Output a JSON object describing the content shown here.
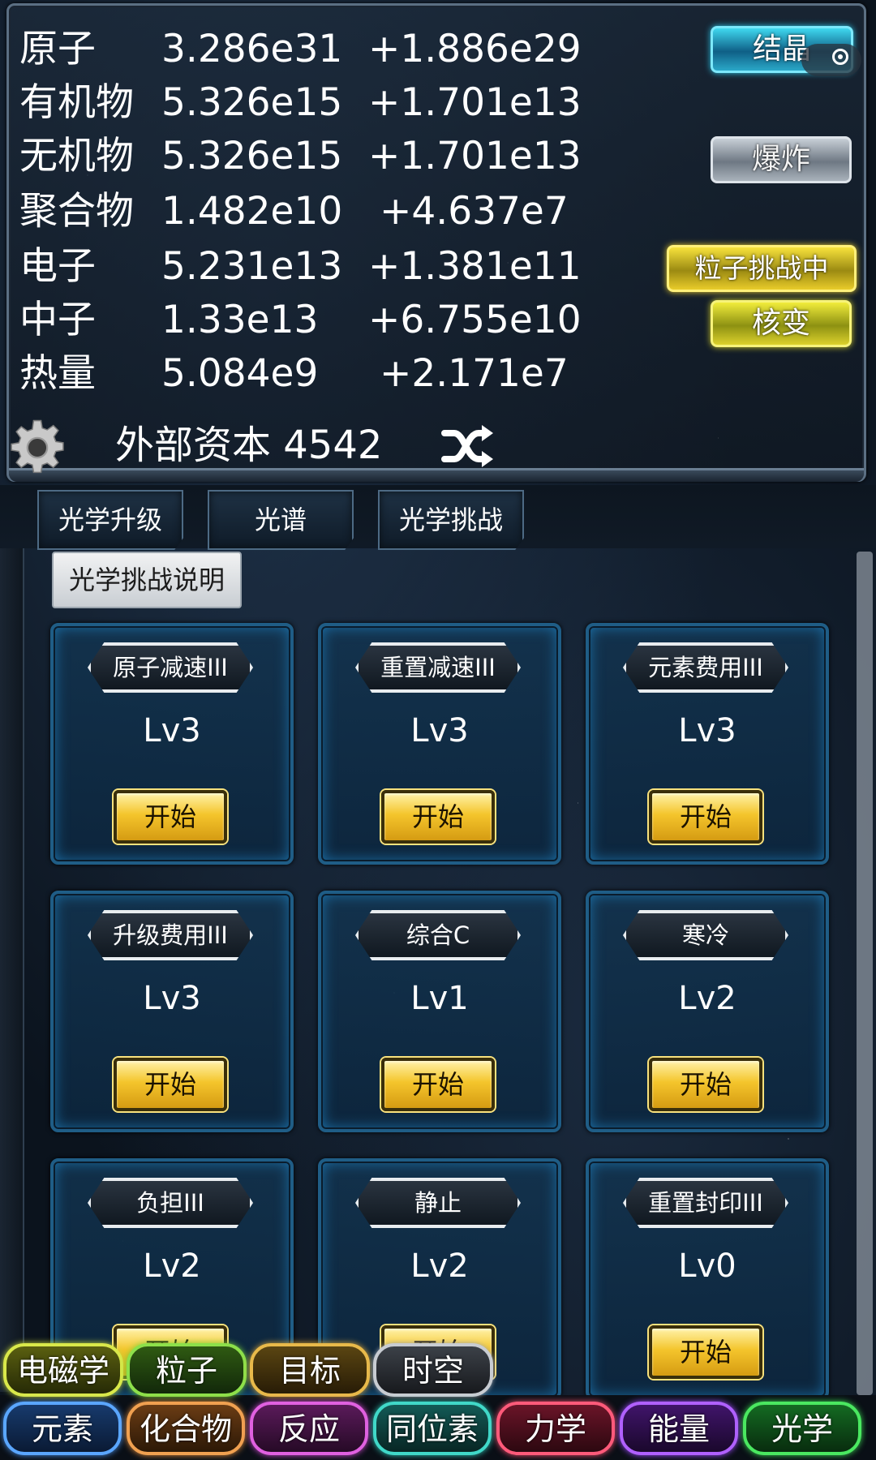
{
  "resources": [
    {
      "name": "原子",
      "value": "3.286e31",
      "rate": "+1.886e29"
    },
    {
      "name": "有机物",
      "value": "5.326e15",
      "rate": "+1.701e13"
    },
    {
      "name": "无机物",
      "value": "5.326e15",
      "rate": "+1.701e13"
    },
    {
      "name": "聚合物",
      "value": "1.482e10",
      "rate": "+4.637e7"
    },
    {
      "name": "电子",
      "value": "5.231e13",
      "rate": "+1.381e11"
    },
    {
      "name": "中子",
      "value": "1.33e13",
      "rate": "+6.755e10"
    },
    {
      "name": "热量",
      "value": "5.084e9",
      "rate": "+2.171e7"
    }
  ],
  "side_buttons": {
    "crystal": "结晶",
    "explode": "爆炸",
    "particle_challenge": "粒子挑战中",
    "nuclear": "核变"
  },
  "capital": "外部资本 4542",
  "icons": [
    "gear-icon",
    "shuffle-icon",
    "wechat-capsule-icon"
  ],
  "sub_tabs": [
    "光学升级",
    "光谱",
    "光学挑战"
  ],
  "explain_button": "光学挑战说明",
  "challenges": [
    {
      "title": "原子减速III",
      "level": "Lv3",
      "start": "开始"
    },
    {
      "title": "重置减速III",
      "level": "Lv3",
      "start": "开始"
    },
    {
      "title": "元素费用III",
      "level": "Lv3",
      "start": "开始"
    },
    {
      "title": "升级费用III",
      "level": "Lv3",
      "start": "开始"
    },
    {
      "title": "综合C",
      "level": "Lv1",
      "start": "开始"
    },
    {
      "title": "寒冷",
      "level": "Lv2",
      "start": "开始"
    },
    {
      "title": "负担III",
      "level": "Lv2",
      "start": "开始"
    },
    {
      "title": "静止",
      "level": "Lv2",
      "start": "开始"
    },
    {
      "title": "重置封印III",
      "level": "Lv0",
      "start": "开始"
    }
  ],
  "nav_row1": [
    "电磁学",
    "粒子",
    "目标",
    "时空"
  ],
  "nav_row2": [
    "元素",
    "化合物",
    "反应",
    "同位素",
    "力学",
    "能量",
    "光学"
  ],
  "colors": {
    "crystal": "#3fd8ef",
    "challenge_gold": "#f7e23c",
    "card_border": "#1f5d86",
    "start_gold": "#f4c52c"
  }
}
